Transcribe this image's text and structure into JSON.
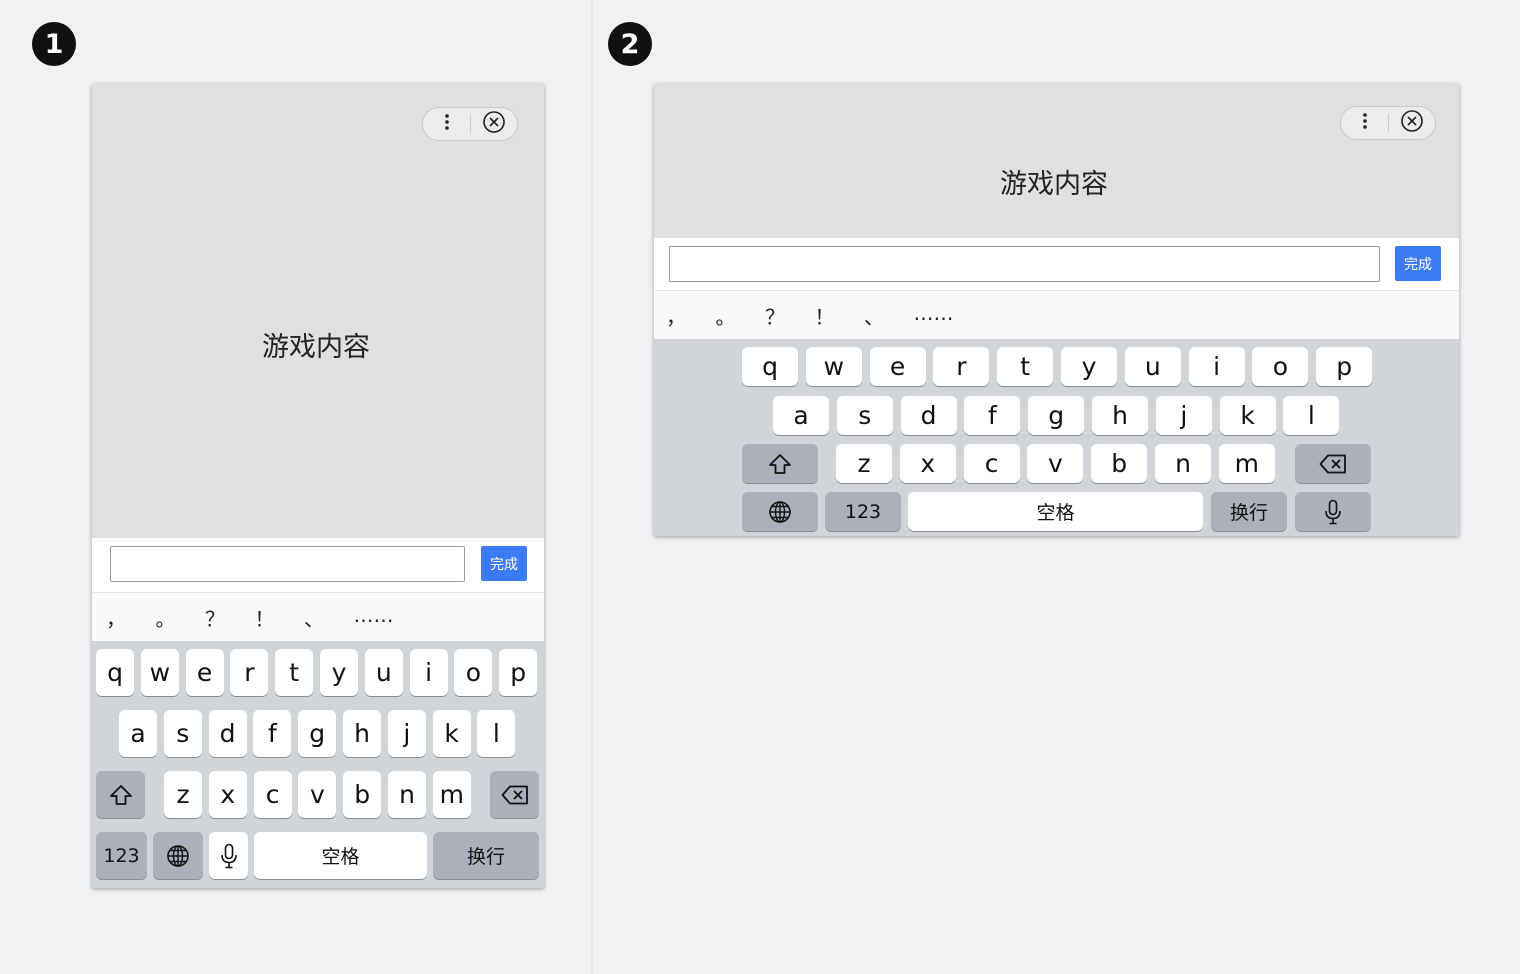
{
  "badges": [
    "1",
    "2"
  ],
  "game": {
    "content_label": "游戏内容"
  },
  "input": {
    "value": "",
    "done_label": "完成"
  },
  "punctuation": [
    "，",
    "。",
    "？",
    "！",
    "、",
    "……"
  ],
  "keyboard": {
    "row1": [
      "q",
      "w",
      "e",
      "r",
      "t",
      "y",
      "u",
      "i",
      "o",
      "p"
    ],
    "row2": [
      "a",
      "s",
      "d",
      "f",
      "g",
      "h",
      "j",
      "k",
      "l"
    ],
    "row3": [
      "z",
      "x",
      "c",
      "v",
      "b",
      "n",
      "m"
    ],
    "numbers_label": "123",
    "space_label": "空格",
    "return_label": "换行"
  },
  "colors": {
    "accent": "#3b7cf6",
    "keyboard_bg": "#d1d4d9",
    "game_bg": "#e0e0e0"
  },
  "icons": [
    "more-icon",
    "close-circle-icon",
    "shift-icon",
    "backspace-icon",
    "globe-icon",
    "microphone-icon"
  ]
}
